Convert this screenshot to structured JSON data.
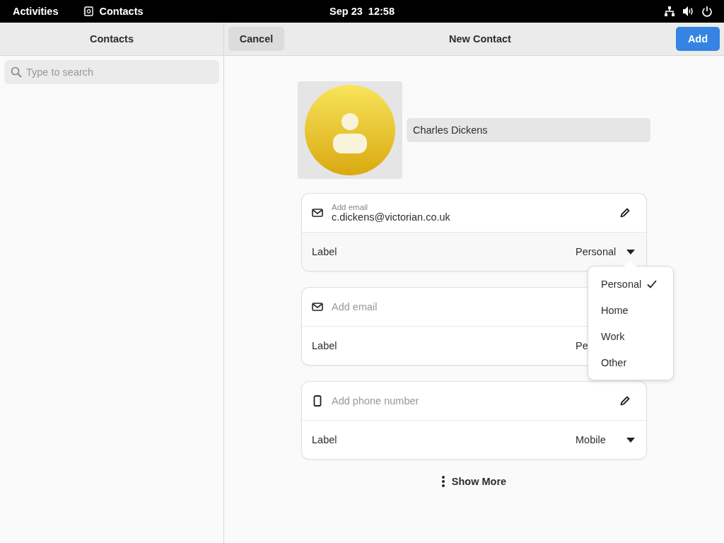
{
  "top_bar": {
    "activities": "Activities",
    "app_name": "Contacts",
    "clock": "Sep 23  12:58"
  },
  "sidebar": {
    "title": "Contacts",
    "search": {
      "placeholder": "Type to search"
    }
  },
  "header": {
    "cancel": "Cancel",
    "title": "New Contact",
    "add": "Add"
  },
  "contact": {
    "name": "Charles Dickens"
  },
  "cards": [
    {
      "kind": "email",
      "field_label": "Add email",
      "value": "c.dickens@victorian.co.uk",
      "label": "Label",
      "label_value": "Personal"
    },
    {
      "kind": "email",
      "placeholder": "Add email",
      "label": "Label",
      "label_value": "Pe"
    },
    {
      "kind": "phone",
      "placeholder": "Add phone number",
      "label": "Label",
      "label_value": "Mobile"
    }
  ],
  "label_menu": [
    {
      "label": "Personal",
      "selected": true
    },
    {
      "label": "Home",
      "selected": false
    },
    {
      "label": "Work",
      "selected": false
    },
    {
      "label": "Other",
      "selected": false
    }
  ],
  "show_more": "Show More"
}
